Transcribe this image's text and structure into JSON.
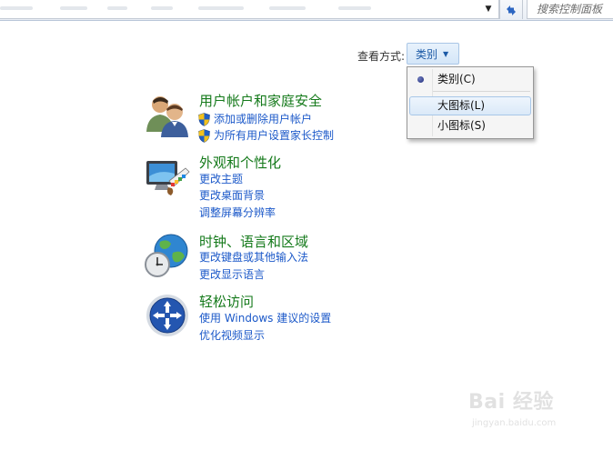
{
  "toolbar": {
    "search_placeholder": "搜索控制面板",
    "address_dropdown_icon": "chevron-down-icon",
    "refresh_icon": "refresh-arrows-icon"
  },
  "view_by": {
    "label": "查看方式:",
    "selected": "类别"
  },
  "view_menu": {
    "items": [
      {
        "label": "类别(C)",
        "checked": true
      },
      {
        "label": "大图标(L)",
        "highlighted": true
      },
      {
        "label": "小图标(S)"
      }
    ]
  },
  "categories": [
    {
      "title": "用户帐户和家庭安全",
      "icon": "users-icon",
      "links": [
        "添加或删除用户帐户",
        "为所有用户设置家长控制"
      ],
      "link_shield": true
    },
    {
      "title": "外观和个性化",
      "icon": "display-paint-icon",
      "links": [
        "更改主题",
        "更改桌面背景",
        "调整屏幕分辨率"
      ]
    },
    {
      "title": "时钟、语言和区域",
      "icon": "globe-clock-icon",
      "links": [
        "更改键盘或其他输入法",
        "更改显示语言"
      ]
    },
    {
      "title": "轻松访问",
      "icon": "ease-of-access-icon",
      "links": [
        "使用 Windows 建议的设置",
        "优化视频显示"
      ]
    }
  ],
  "colors": {
    "category_title": "#157a1b",
    "link": "#1c59c9",
    "accent": "#1c5aa6"
  },
  "watermark": {
    "text": "Bai 经验",
    "url_text": "jingyan.baidu.com"
  }
}
